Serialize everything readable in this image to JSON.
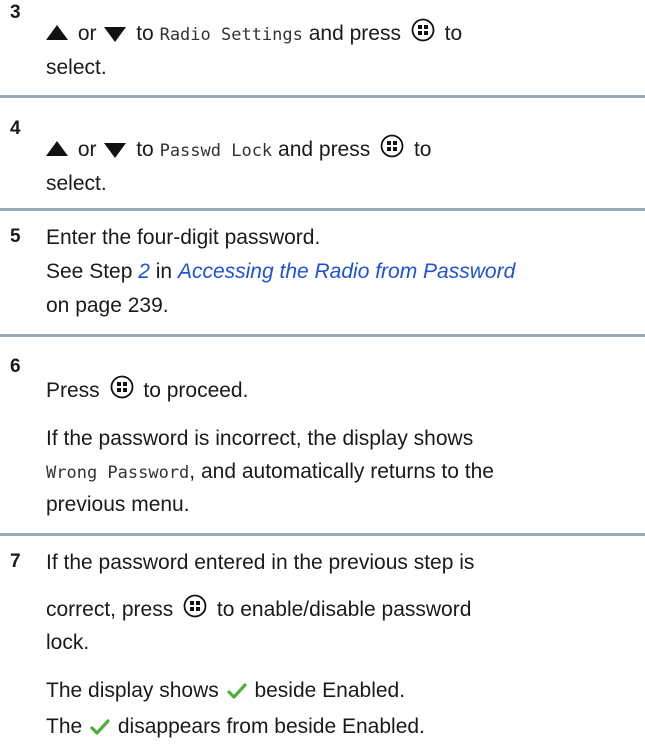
{
  "steps": [
    {
      "number": "3",
      "lines": [
        {
          "s1": "or",
          "s2": "to",
          "mono": "Radio Settings",
          "s3": "and press",
          "s4": "to"
        },
        {
          "text": "select."
        }
      ]
    },
    {
      "number": "4",
      "lines": [
        {
          "s1": "or",
          "s2": "to",
          "mono": "Passwd Lock",
          "s3": "and press",
          "s4": "to"
        },
        {
          "text": "select."
        }
      ]
    },
    {
      "number": "5",
      "lines": [
        {
          "text": "Enter the four-digit password."
        },
        {
          "pre": "See Step ",
          "link1": "2",
          "mid": " in ",
          "link2": "Accessing the Radio from Password"
        },
        {
          "text": "on page 239."
        }
      ]
    },
    {
      "number": "6",
      "lines": [
        {
          "pre": "Press",
          "post": "to proceed."
        },
        {
          "text": "If the password is incorrect, the display shows"
        },
        {
          "mono": "Wrong Password",
          "post": ", and automatically returns to the"
        },
        {
          "text": "previous menu."
        }
      ]
    },
    {
      "number": "7",
      "lines": [
        {
          "text": "If the password entered in the previous step is"
        },
        {
          "pre": "correct, press",
          "post": "to enable/disable password"
        },
        {
          "text": "lock."
        },
        {
          "pre": "The display shows",
          "post": "beside Enabled."
        },
        {
          "pre": "The",
          "post": "disappears from beside Enabled."
        }
      ]
    }
  ],
  "icons": {
    "up": "up-arrow-icon",
    "down": "down-arrow-icon",
    "menu_ok": "menu-ok-button-icon",
    "check": "checkmark-icon"
  },
  "colors": {
    "link": "#1f51d8",
    "separator": "#9aa8bc",
    "check": "#4caf3a"
  }
}
